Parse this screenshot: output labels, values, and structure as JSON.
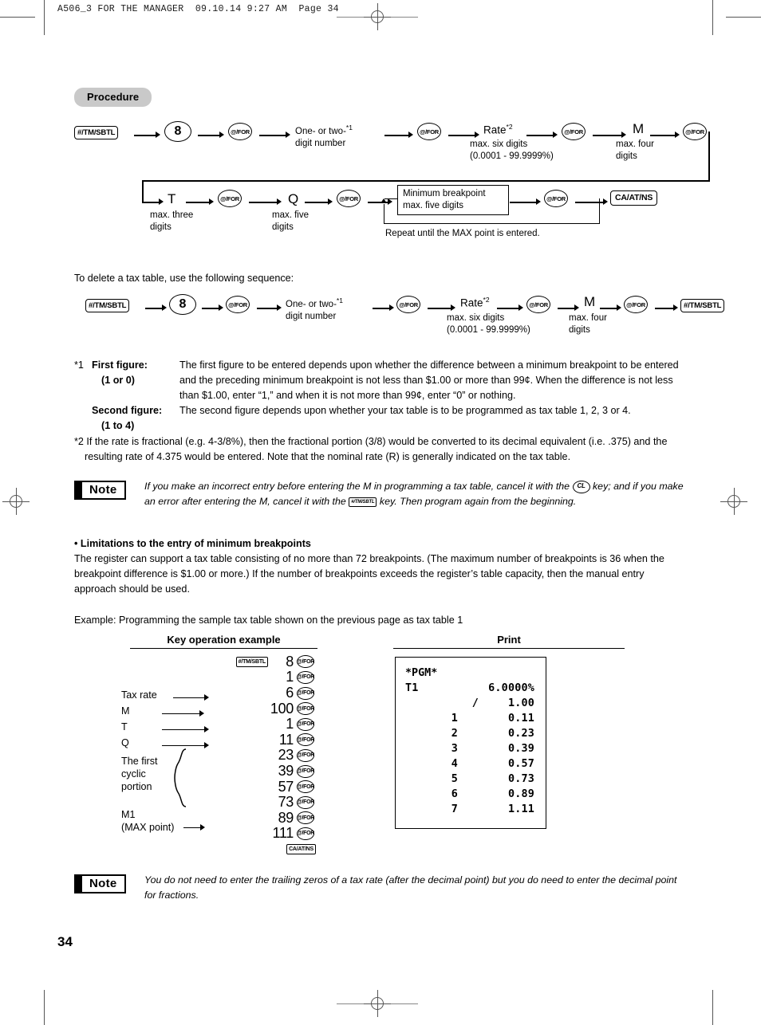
{
  "header": {
    "print_mark": "A506_3 FOR THE MANAGER  09.10.14 9:27 AM  Page 34"
  },
  "page_number": "34",
  "procedure": {
    "badge": "Procedure",
    "row1": {
      "key_tmsbtl": "#/TM/SBTL",
      "key_8": "8",
      "key_for": "@/FOR",
      "node_number_line1": "One- or two-",
      "node_number_sup": "*1",
      "node_number_line2": "digit number",
      "node_rate": "Rate",
      "node_rate_sup": "*2",
      "node_rate_sub1": "max. six digits",
      "node_rate_sub2": "(0.0001 - 99.9999%)",
      "node_m": "M",
      "node_m_sub1": "max. four",
      "node_m_sub2": "digits"
    },
    "row2": {
      "node_t": "T",
      "node_t_sub1": "max. three",
      "node_t_sub2": "digits",
      "node_q": "Q",
      "node_q_sub1": "max. five",
      "node_q_sub2": "digits",
      "key_for": "@/FOR",
      "breakpoint_box_line1": "Minimum breakpoint",
      "breakpoint_box_line2": "max. five digits",
      "repeat_caption": "Repeat until the MAX point is entered.",
      "key_caatns": "CA/AT/NS"
    }
  },
  "delete": {
    "intro": "To delete a tax table, use the following sequence:",
    "key_tmsbtl": "#/TM/SBTL",
    "key_8": "8",
    "key_for": "@/FOR",
    "node_number_line1": "One- or two-",
    "node_number_sup": "*1",
    "node_number_line2": "digit number",
    "node_rate": "Rate",
    "node_rate_sup": "*2",
    "node_rate_sub1": "max. six digits",
    "node_rate_sub2": "(0.0001 - 99.9999%)",
    "node_m": "M",
    "node_m_sub1": "max. four",
    "node_m_sub2": "digits",
    "key_tmsbtl_end": "#/TM/SBTL"
  },
  "footnotes": {
    "star1_marker": "*1",
    "first_figure_label": "First figure:",
    "first_figure_range": "(1 or 0)",
    "first_figure_text": "The first figure to be entered depends upon whether the difference between a minimum breakpoint to be entered and the preceding minimum breakpoint is not less than $1.00 or more than 99¢. When the difference is not less than $1.00, enter “1,” and when it is not more than 99¢, enter “0” or nothing.",
    "second_figure_label": "Second figure:",
    "second_figure_range": "(1 to 4)",
    "second_figure_text": "The second figure depends upon whether your tax table is to be programmed as tax table 1, 2, 3 or 4.",
    "star2_marker": "*2",
    "star2_text": "If the rate is fractional (e.g. 4-3/8%), then the fractional portion (3/8) would be converted to its decimal equivalent (i.e. .375) and the resulting rate of 4.375 would be entered. Note that the nominal rate (R) is generally indicated on the tax table."
  },
  "note1": {
    "label": "Note",
    "text_part1": "If you make an incorrect entry before entering the M in programming a tax table, cancel it with the",
    "key_cl": "CL",
    "text_part2": "key; and if you make an error after entering the M, cancel it with the",
    "key_tmsbtl": "#/TM/SBTL",
    "text_part3": "key.  Then program again from the beginning."
  },
  "limitations": {
    "heading": "• Limitations to the entry of minimum breakpoints",
    "body": "The register can support a tax table consisting of no more than 72 breakpoints. (The maximum number of breakpoints is 36 when the breakpoint difference is $1.00 or more.) If the number of breakpoints exceeds the register’s table capacity, then the manual entry approach should be used.",
    "example": "Example: Programming the sample tax table shown on the previous page as tax table 1"
  },
  "example": {
    "key_col_title": "Key operation example",
    "print_col_title": "Print",
    "key_first": "#/TM/SBTL",
    "key_for": "@/FOR",
    "key_last": "CA/AT/NS",
    "rows": [
      {
        "value": "8",
        "key": "@/FOR"
      },
      {
        "value": "1",
        "key": "@/FOR"
      },
      {
        "value": "6",
        "key": "@/FOR"
      },
      {
        "value": "100",
        "key": "@/FOR"
      },
      {
        "value": "1",
        "key": "@/FOR"
      },
      {
        "value": "11",
        "key": "@/FOR"
      },
      {
        "value": "23",
        "key": "@/FOR"
      },
      {
        "value": "39",
        "key": "@/FOR"
      },
      {
        "value": "57",
        "key": "@/FOR"
      },
      {
        "value": "73",
        "key": "@/FOR"
      },
      {
        "value": "89",
        "key": "@/FOR"
      },
      {
        "value": "111",
        "key": "@/FOR"
      }
    ],
    "labels": {
      "tax_rate": "Tax rate",
      "m": "M",
      "t": "T",
      "q": "Q",
      "cyclic_line1": "The first",
      "cyclic_line2": "cyclic",
      "cyclic_line3": "portion",
      "m1": "M1",
      "max_point": "(MAX point)"
    },
    "print": {
      "title": "*PGM*",
      "table_label": "T1",
      "rate": "6.0000%",
      "slash": "/",
      "base": "1.00",
      "rows": [
        {
          "no": "1",
          "amount": "0.11"
        },
        {
          "no": "2",
          "amount": "0.23"
        },
        {
          "no": "3",
          "amount": "0.39"
        },
        {
          "no": "4",
          "amount": "0.57"
        },
        {
          "no": "5",
          "amount": "0.73"
        },
        {
          "no": "6",
          "amount": "0.89"
        },
        {
          "no": "7",
          "amount": "1.11"
        }
      ]
    }
  },
  "note2": {
    "label": "Note",
    "text": "You do not need to enter the trailing zeros of a tax rate (after the decimal point) but you do need to enter the decimal point for fractions."
  }
}
